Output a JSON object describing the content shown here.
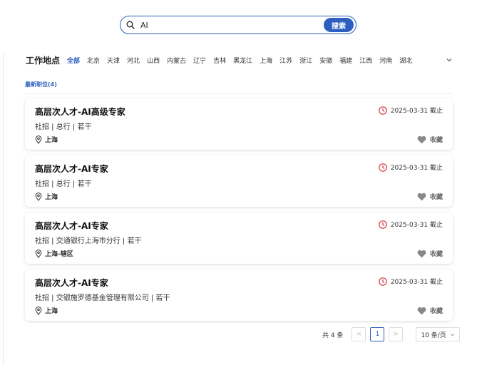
{
  "search": {
    "value": "AI",
    "button_label": "搜索"
  },
  "location_filter": {
    "title": "工作地点",
    "items": [
      {
        "label": "全部",
        "active": true
      },
      {
        "label": "北京"
      },
      {
        "label": "天津"
      },
      {
        "label": "河北"
      },
      {
        "label": "山西"
      },
      {
        "label": "内蒙古"
      },
      {
        "label": "辽宁"
      },
      {
        "label": "吉林"
      },
      {
        "label": "黑龙江"
      },
      {
        "label": "上海"
      },
      {
        "label": "江苏"
      },
      {
        "label": "浙江"
      },
      {
        "label": "安徽"
      },
      {
        "label": "福建"
      },
      {
        "label": "江西"
      },
      {
        "label": "河南"
      },
      {
        "label": "湖北"
      }
    ]
  },
  "section": {
    "label": "最新职位(4)"
  },
  "jobs": [
    {
      "title": "高层次人才-AI高级专家",
      "meta": "社招 | 总行 | 若干",
      "location": "上海",
      "deadline": "2025-03-31 截止",
      "fav_label": "收藏"
    },
    {
      "title": "高层次人才-AI专家",
      "meta": "社招 | 总行 | 若干",
      "location": "上海",
      "deadline": "2025-03-31 截止",
      "fav_label": "收藏"
    },
    {
      "title": "高层次人才-AI专家",
      "meta": "社招 | 交通银行上海市分行 | 若干",
      "location": "上海-辖区",
      "deadline": "2025-03-31 截止",
      "fav_label": "收藏"
    },
    {
      "title": "高层次人才-AI专家",
      "meta": "社招 | 交银施罗德基金管理有限公司 | 若干",
      "location": "上海",
      "deadline": "2025-03-31 截止",
      "fav_label": "收藏"
    }
  ],
  "pagination": {
    "total": "共 4 条",
    "prev": "<",
    "current": "1",
    "next": ">",
    "page_size": "10 条/页"
  },
  "colors": {
    "accent": "#2d5fc0",
    "deadline_icon": "#d9363e",
    "heart": "#888888"
  }
}
